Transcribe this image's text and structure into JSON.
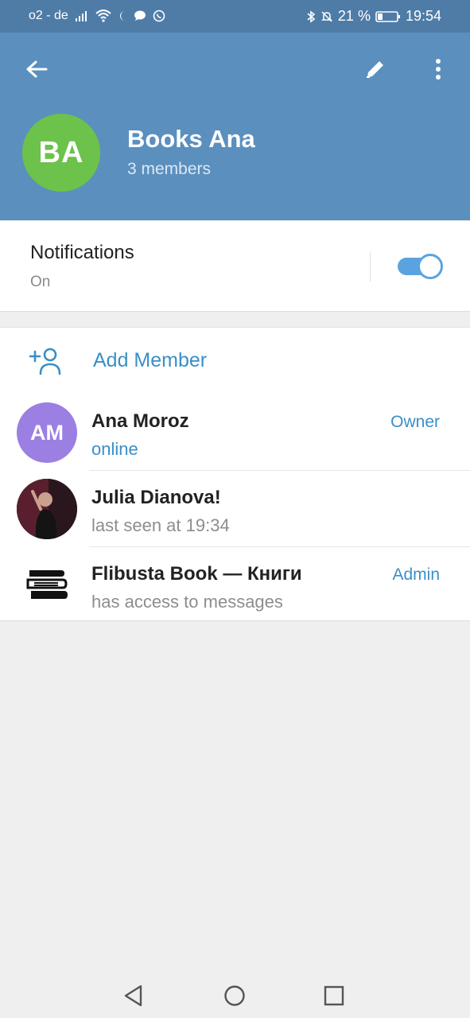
{
  "status_bar": {
    "carrier": "o2 - de",
    "battery": "21 %",
    "time": "19:54",
    "icons": [
      "signal-icon",
      "wifi-icon",
      "moon-icon",
      "chat-bubble-icon",
      "whatsapp-icon",
      "bluetooth-icon",
      "bell-off-icon",
      "battery-icon"
    ]
  },
  "header": {
    "avatar_initials": "BA",
    "avatar_color": "#6cc24a",
    "title": "Books Ana",
    "subtitle": "3 members",
    "background": "#5b8fbe"
  },
  "notifications": {
    "title": "Notifications",
    "state": "On",
    "enabled": true
  },
  "members_section": {
    "add_label": "Add Member",
    "members": [
      {
        "initials": "AM",
        "avatar_color": "#9b7fe3",
        "name": "Ana Moroz",
        "status": "online",
        "role": "Owner"
      },
      {
        "initials": "",
        "avatar_color": "#3a1e28",
        "name": "Julia Dianova!",
        "status": "last seen at 19:34",
        "role": ""
      },
      {
        "initials": "",
        "avatar_color": "#ffffff",
        "name": "Flibusta Book — Книги",
        "status": "has access to messages",
        "role": "Admin"
      }
    ]
  },
  "accent_color": "#3a8fc8"
}
